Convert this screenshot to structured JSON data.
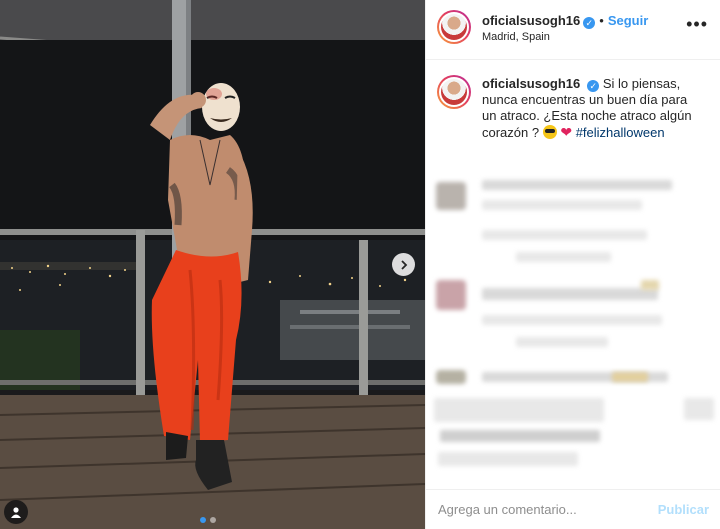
{
  "post": {
    "username": "oficialsusogh16",
    "verified_icon": "verified-badge-icon",
    "follow_label": "Seguir",
    "separator": "•",
    "location": "Madrid, Spain",
    "more_icon": "more-options-icon",
    "more_symbol": "•••"
  },
  "caption": {
    "username": "oficialsusogh16",
    "text": "Si lo piensas, nunca encuentras un buen día para un atraco. ¿Esta noche atraco algún corazón ?",
    "emojis": [
      "sunglasses-emoji",
      "red-heart-emoji"
    ],
    "heart_symbol": "❤",
    "hashtag": "#felizhalloween"
  },
  "carousel": {
    "next_icon": "chevron-right-icon",
    "user_tag_icon": "user-tag-icon",
    "slide_count": 2,
    "active_slide": 1
  },
  "comment_box": {
    "placeholder": "Agrega un comentario...",
    "publish_label": "Publicar"
  },
  "colors": {
    "accent": "#3897f0",
    "publish_disabled": "#b2dffc",
    "hashtag": "#00376b",
    "pants": "#e8401c"
  }
}
